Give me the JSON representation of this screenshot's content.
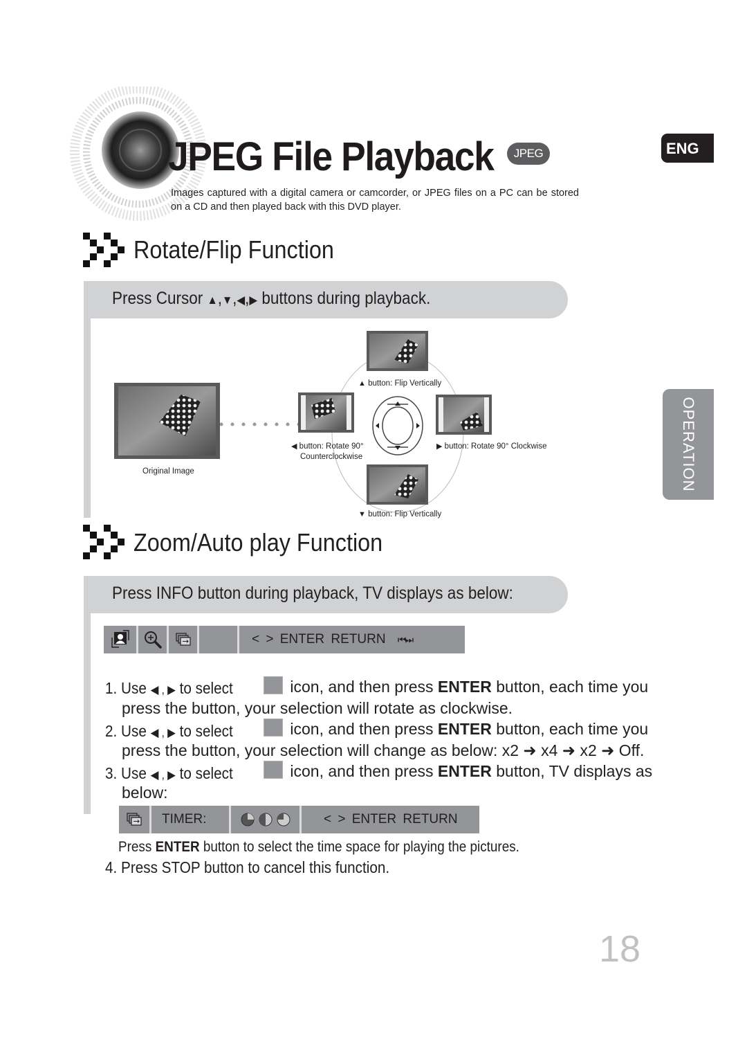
{
  "header": {
    "title": "JPEG File Playback",
    "badge": "JPEG",
    "intro": "Images captured with a digital camera or camcorder, or JPEG files on a PC can be stored on a CD and then played back with this DVD player."
  },
  "side_tabs": {
    "language": "ENG",
    "chapter": "OPERATION"
  },
  "rotate_section": {
    "title": "Rotate/Flip Function",
    "instruction_prefix": "Press Cursor",
    "instruction_arrows": [
      "▲",
      "▼",
      "◀",
      "▶"
    ],
    "instruction_suffix": "buttons during playback.",
    "original_caption": "Original Image",
    "up_caption": "button: Flip Vertically",
    "left_caption_line1": "button: Rotate 90°",
    "left_caption_line2": "Counterclockwise",
    "right_caption": "button: Rotate 90° Clockwise",
    "down_caption": "button: Flip Vertically",
    "up_arrow": "▲",
    "down_arrow": "▼",
    "left_arrow": "◀",
    "right_arrow": "▶"
  },
  "zoom_section": {
    "title": "Zoom/Auto play Function",
    "instruction": "Press INFO button during playback, TV displays as below:",
    "osd_text": "< >  ENTER  RETURN",
    "osd_skip": "⏮⏭",
    "steps": [
      {
        "num": "1.",
        "use": "Use",
        "arrows": "◀ ,  ▶",
        "to_select": "to select",
        "after_icon": "icon, and then press",
        "bold": "ENTER",
        "rest": "button, each time you",
        "line2": "press the button, your selection will rotate as clockwise."
      },
      {
        "num": "2.",
        "use": "Use",
        "arrows": "◀ ,  ▶",
        "to_select": "to select",
        "after_icon": "icon, and then press",
        "bold": "ENTER",
        "rest": "button, each time you",
        "line2": "press the button, your selection will change as below: x2 ➜ x4 ➜ x2 ➜ Off."
      },
      {
        "num": "3.",
        "use": "Use",
        "arrows": "◀ ,  ▶",
        "to_select": "to select",
        "after_icon": "icon, and then press",
        "bold": "ENTER",
        "rest": "button, TV displays as",
        "line2": "below:"
      }
    ],
    "timer_osd": {
      "label": "TIMER:",
      "text": "< >  ENTER  RETURN"
    },
    "enter_note_prefix": "Press",
    "enter_note_bold": "ENTER",
    "enter_note_rest": "button to select the time space for playing the pictures.",
    "step4": "4. Press STOP button to cancel this function."
  },
  "page_number": "18"
}
